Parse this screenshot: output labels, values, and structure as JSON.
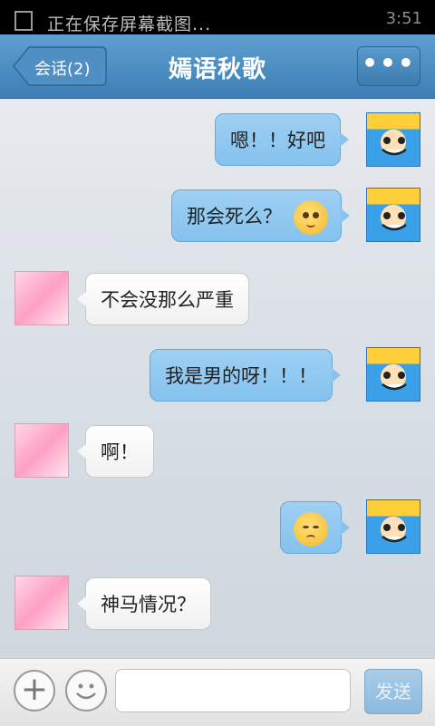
{
  "statusbar": {
    "notification": "正在保存屏幕截图...",
    "time": "3:51"
  },
  "header": {
    "back_label": "会话(2)",
    "title": "嫣语秋歌",
    "more_label": "•••"
  },
  "messages": [
    {
      "sender": "me",
      "text": "嗯！！好吧",
      "emoji": ""
    },
    {
      "sender": "me",
      "text": "那会死么？",
      "emoji": "sad-face"
    },
    {
      "sender": "other",
      "text": "不会没那么严重",
      "emoji": ""
    },
    {
      "sender": "me",
      "text": "我是男的呀！！！",
      "emoji": ""
    },
    {
      "sender": "other",
      "text": "啊！",
      "emoji": ""
    },
    {
      "sender": "me",
      "text": "",
      "emoji": "shy-face"
    },
    {
      "sender": "other",
      "text": "神马情况？",
      "emoji": ""
    }
  ],
  "inputbar": {
    "text_value": "",
    "send_label": "发送"
  },
  "colors": {
    "title_bar": "#4a8cc2",
    "my_bubble": "#8fc8f0",
    "other_bubble": "#ffffff"
  }
}
